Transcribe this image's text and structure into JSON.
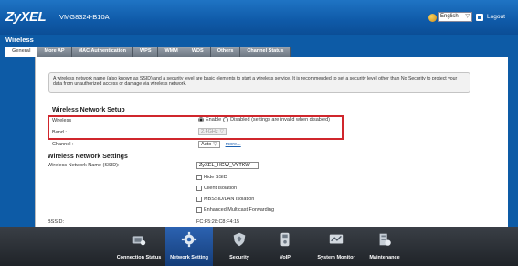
{
  "header": {
    "brand": "ZyXEL",
    "model": "VMG8324-B10A",
    "language": "English",
    "logout_label": "Logout"
  },
  "section_title": "Wireless",
  "tabs": [
    {
      "label": "General",
      "active": true
    },
    {
      "label": "More AP"
    },
    {
      "label": "MAC Authentication"
    },
    {
      "label": "WPS"
    },
    {
      "label": "WMM"
    },
    {
      "label": "WDS"
    },
    {
      "label": "Others"
    },
    {
      "label": "Channel Status"
    }
  ],
  "notice": "A wireless network name (also known as SSID) and a security level are basic elements to start a wireless service. It is recommended to set a security level other than No Security to protect your data from unauthorized access or damage via wireless network.",
  "setup": {
    "title": "Wireless Network Setup",
    "wireless_label": "Wireless",
    "enable_label": "Enable",
    "disable_label": "Disabled (settings are invalid when disabled)",
    "band_label": "Band :",
    "band_value": "2.4GHz",
    "channel_label": "Channel :",
    "channel_value": "Auto",
    "channel_more": "more..."
  },
  "settings": {
    "title": "Wireless Network Settings",
    "ssid_label": "Wireless Network Name (SSID):",
    "ssid_value": "ZyXEL_HGW_VYTKW",
    "hide_ssid": "Hide SSID",
    "client_isolation": "Client Isolation",
    "mbssid_isolation": "MBSSID/LAN Isolation",
    "multicast": "Enhanced Multicast Forwarding",
    "bssid_label": "BSSID:",
    "bssid_value": "FC:F5:28:C8:F4:15"
  },
  "bottom_nav": [
    {
      "label": "Connection Status",
      "icon": "connection-status-icon"
    },
    {
      "label": "Network Setting",
      "icon": "network-setting-icon",
      "active": true
    },
    {
      "label": "Security",
      "icon": "security-shield-icon"
    },
    {
      "label": "VoIP",
      "icon": "voip-phone-icon"
    },
    {
      "label": "System Monitor",
      "icon": "system-monitor-icon"
    },
    {
      "label": "Maintenance",
      "icon": "maintenance-icon"
    }
  ],
  "colors": {
    "header_blue": "#0f5aa8",
    "highlight_red": "#d0262c",
    "active_nav": "#2c63b2"
  }
}
